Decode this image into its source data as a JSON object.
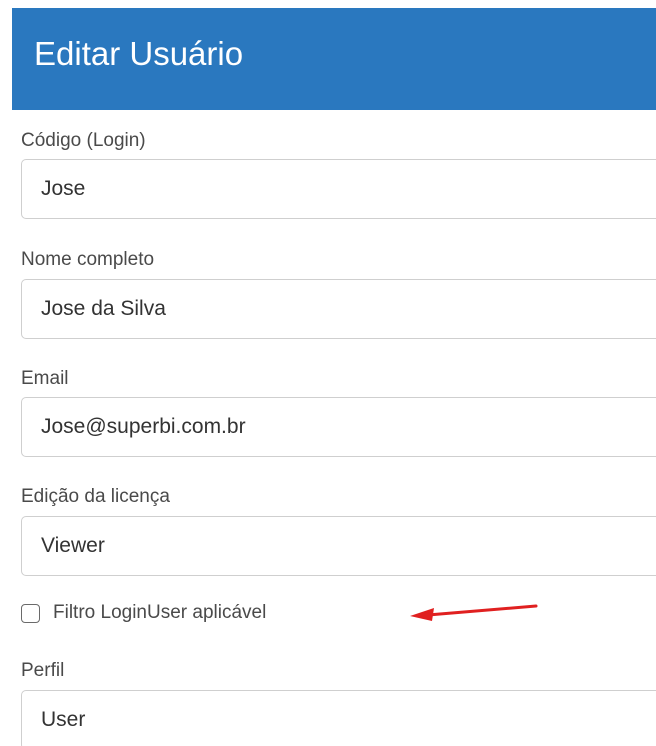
{
  "dialog": {
    "title": "Editar Usuário"
  },
  "form": {
    "login": {
      "label": "Código (Login)",
      "value": "Jose"
    },
    "full_name": {
      "label": "Nome completo",
      "value": "Jose da Silva"
    },
    "email": {
      "label": "Email",
      "value": "Jose@superbi.com.br"
    },
    "license": {
      "label": "Edição da licença",
      "value": "Viewer"
    },
    "login_filter": {
      "label": "Filtro LoginUser aplicável",
      "checked": false
    },
    "profile": {
      "label": "Perfil",
      "value": "User"
    }
  },
  "annotation": {
    "arrow_color": "#e02020",
    "arrow_icon": "arrow-left-icon"
  },
  "colors": {
    "header_bg": "#2a78bf",
    "border": "#cfcfcf"
  }
}
